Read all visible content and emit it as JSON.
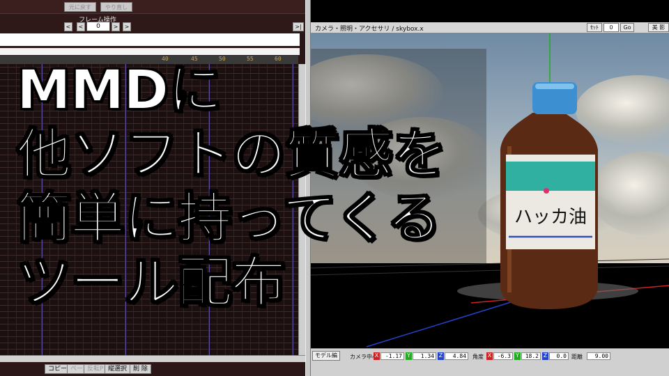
{
  "timeline": {
    "undo_label": "元に戻す",
    "redo_label": "やり直し",
    "frame_ops_label": "フレーム操作",
    "frame_value": "0",
    "nav": {
      "first": "<",
      "prev": "<",
      "next": ">",
      "last": ">",
      "end": ">|"
    },
    "ruler_ticks": [
      "40",
      "45",
      "50",
      "55",
      "60"
    ],
    "bottom_buttons": [
      {
        "label": "コピー",
        "enabled": true
      },
      {
        "label": "ペースト",
        "enabled": false
      },
      {
        "label": "反転P",
        "enabled": false
      },
      {
        "label": "縦選択",
        "enabled": true
      },
      {
        "label": "削 除",
        "enabled": true
      }
    ]
  },
  "viewport": {
    "title": "カメラ・照明・アクセサリ / skybox.x",
    "controls": {
      "set_label": "ｾｯﾄ",
      "set_value": "0",
      "go_label": "Go",
      "extra": "美 影"
    },
    "bottle_label": "ハッカ油",
    "status": {
      "model_tab": "モデル編",
      "camera_center_label": "カメラ中心",
      "camera_center": {
        "x": "-1.17",
        "y": "1.34",
        "z": "4.84"
      },
      "angle_label": "角度",
      "angle": {
        "x": "-6.3",
        "y": "18.2",
        "z": "0.0"
      },
      "distance_label": "距離",
      "distance": "9.00"
    },
    "axis_colors": {
      "x": "#cc2222",
      "y": "#22aa22",
      "z": "#2244cc"
    }
  },
  "headline": {
    "lines": [
      "MMDに",
      "他ソフトの質感を",
      "簡単に持ってくる",
      "ツール配布"
    ]
  }
}
